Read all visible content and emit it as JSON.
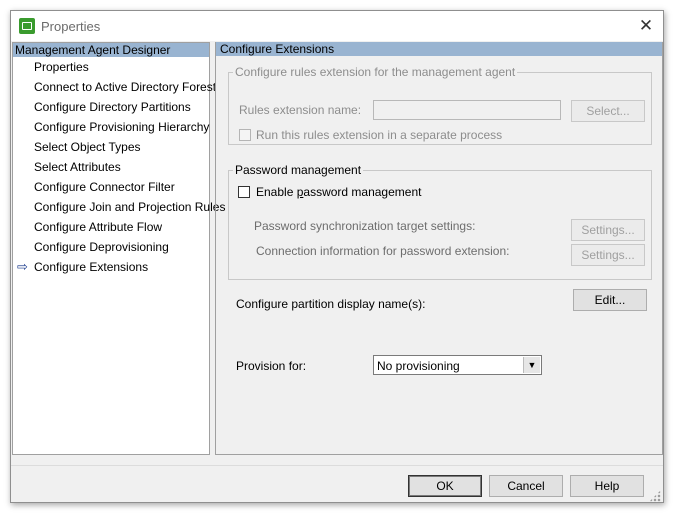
{
  "window": {
    "title": "Properties",
    "close_glyph": "✕",
    "app_icon": "properties-app-icon"
  },
  "left": {
    "header": "Management Agent Designer",
    "current_marker": "⇨",
    "items": [
      {
        "label": "Properties"
      },
      {
        "label": "Connect to Active Directory Forest"
      },
      {
        "label": "Configure Directory Partitions"
      },
      {
        "label": "Configure Provisioning Hierarchy"
      },
      {
        "label": "Select Object Types"
      },
      {
        "label": "Select Attributes"
      },
      {
        "label": "Configure Connector Filter"
      },
      {
        "label": "Configure Join and Projection Rules"
      },
      {
        "label": "Configure Attribute Flow"
      },
      {
        "label": "Configure Deprovisioning"
      },
      {
        "label": "Configure Extensions",
        "current": true
      }
    ]
  },
  "right": {
    "header": "Configure Extensions",
    "rules": {
      "legend": "Configure rules extension for the management agent",
      "name_label": "Rules extension name:",
      "name_value": "",
      "select_button": "Select...",
      "separate_process_label": "Run this rules extension in a separate process"
    },
    "password": {
      "legend": "Password management",
      "enable_prefix": "Enable ",
      "enable_hotkey": "p",
      "enable_suffix": "assword management",
      "target_label": "Password synchronization target settings:",
      "target_button": "Settings...",
      "connection_label": "Connection information for password extension:",
      "connection_button": "Settings..."
    },
    "partition": {
      "label": "Configure partition display name(s):",
      "edit_button": "Edit..."
    },
    "provision": {
      "label": "Provision for:",
      "selected": "No provisioning"
    }
  },
  "buttons": {
    "ok": "OK",
    "cancel": "Cancel",
    "help": "Help"
  }
}
